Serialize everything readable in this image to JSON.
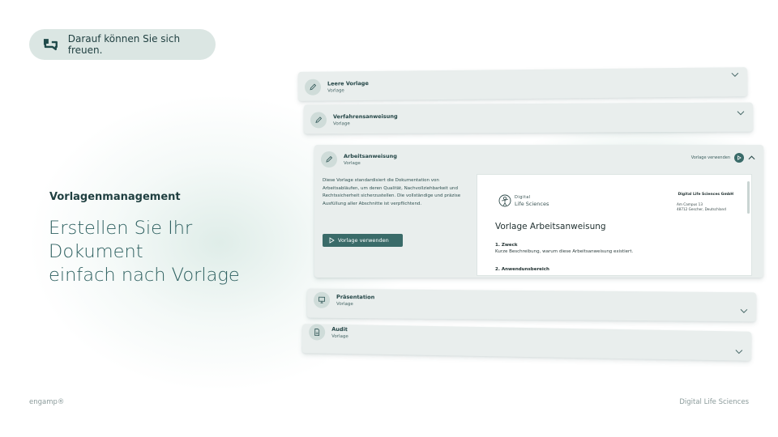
{
  "tagline_pill": {
    "text": "Darauf können Sie sich freuen.",
    "icon": "chat-bubbles-icon"
  },
  "section": {
    "label": "Vorlagenmanagement",
    "headline_line1": "Erstellen Sie Ihr Dokument",
    "headline_line2": "einfach nach Vorlage"
  },
  "templates": [
    {
      "title": "Leere Vorlage",
      "subtitle": "Vorlage",
      "icon": "pencil-icon"
    },
    {
      "title": "Verfahrensanweisung",
      "subtitle": "Vorlage",
      "icon": "pencil-icon"
    },
    {
      "title": "Arbeitsanweisung",
      "subtitle": "Vorlage",
      "icon": "pencil-icon",
      "description": "Diese Vorlage standardisiert die Dokumentation von Arbeitsabläufen, um deren Qualität, Nachvollziehbarkeit und Rechtssicherheit sicherzustellen. Die vollständige und präzise Ausfüllung aller Abschnitte ist verpflichtend.",
      "use_button": "Vorlage verwenden",
      "header_action": "Vorlage verwenden",
      "preview": {
        "logo_top": "Digital",
        "logo_bottom": "Life Sciences",
        "company": "Digital Life Sciences GmbH",
        "address_line1": "Am Campus 13",
        "address_line2": "48712 Gescher, Deutschland",
        "title": "Vorlage Arbeitsanweisung",
        "section1_heading": "1. Zweck",
        "section1_text": "Kurze Beschreibung, warum diese Arbeitsanweisung existiert.",
        "section2_heading": "2. Anwendunsbereich"
      }
    },
    {
      "title": "Präsentation",
      "subtitle": "Vorlage",
      "icon": "presentation-icon"
    },
    {
      "title": "Audit",
      "subtitle": "Vorlage",
      "icon": "document-icon"
    }
  ],
  "footer": {
    "left": "engamp®",
    "right": "Digital Life Sciences"
  },
  "colors": {
    "accent": "#3a6b69",
    "card_bg": "#e9eeed",
    "pill_bg": "#dbe6e3",
    "headline": "#2f6161"
  }
}
